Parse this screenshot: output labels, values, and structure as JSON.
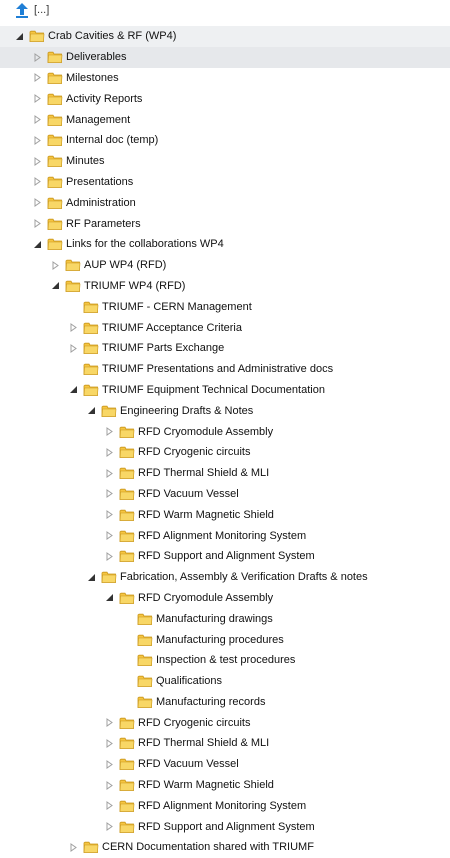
{
  "up": {
    "label": "[...]"
  },
  "tree": [
    {
      "label": "Crab Cavities & RF (WP4)",
      "depth": 0,
      "state": "expanded",
      "highlight": "first"
    },
    {
      "label": "Deliverables",
      "depth": 1,
      "state": "collapsed",
      "highlight": "selected"
    },
    {
      "label": "Milestones",
      "depth": 1,
      "state": "collapsed"
    },
    {
      "label": "Activity Reports",
      "depth": 1,
      "state": "collapsed"
    },
    {
      "label": "Management",
      "depth": 1,
      "state": "collapsed"
    },
    {
      "label": "Internal doc (temp)",
      "depth": 1,
      "state": "collapsed"
    },
    {
      "label": "Minutes",
      "depth": 1,
      "state": "collapsed"
    },
    {
      "label": "Presentations",
      "depth": 1,
      "state": "collapsed"
    },
    {
      "label": "Administration",
      "depth": 1,
      "state": "collapsed"
    },
    {
      "label": "RF Parameters",
      "depth": 1,
      "state": "collapsed"
    },
    {
      "label": "Links for the collaborations WP4",
      "depth": 1,
      "state": "expanded"
    },
    {
      "label": "AUP WP4 (RFD)",
      "depth": 2,
      "state": "collapsed"
    },
    {
      "label": "TRIUMF WP4 (RFD)",
      "depth": 2,
      "state": "expanded"
    },
    {
      "label": "TRIUMF - CERN Management",
      "depth": 3,
      "state": "leaf"
    },
    {
      "label": "TRIUMF Acceptance Criteria",
      "depth": 3,
      "state": "collapsed"
    },
    {
      "label": "TRIUMF Parts Exchange",
      "depth": 3,
      "state": "collapsed"
    },
    {
      "label": "TRIUMF Presentations and Administrative docs",
      "depth": 3,
      "state": "leaf"
    },
    {
      "label": "TRIUMF Equipment Technical Documentation",
      "depth": 3,
      "state": "expanded"
    },
    {
      "label": "Engineering Drafts & Notes",
      "depth": 4,
      "state": "expanded"
    },
    {
      "label": "RFD Cryomodule Assembly",
      "depth": 5,
      "state": "collapsed"
    },
    {
      "label": "RFD Cryogenic circuits",
      "depth": 5,
      "state": "collapsed"
    },
    {
      "label": "RFD Thermal Shield & MLI",
      "depth": 5,
      "state": "collapsed"
    },
    {
      "label": "RFD Vacuum Vessel",
      "depth": 5,
      "state": "collapsed"
    },
    {
      "label": "RFD Warm Magnetic Shield",
      "depth": 5,
      "state": "collapsed"
    },
    {
      "label": "RFD Alignment Monitoring System",
      "depth": 5,
      "state": "collapsed"
    },
    {
      "label": "RFD Support and Alignment System",
      "depth": 5,
      "state": "collapsed"
    },
    {
      "label": "Fabrication, Assembly & Verification Drafts & notes",
      "depth": 4,
      "state": "expanded"
    },
    {
      "label": "RFD Cryomodule Assembly",
      "depth": 5,
      "state": "expanded"
    },
    {
      "label": "Manufacturing drawings",
      "depth": 6,
      "state": "leaf"
    },
    {
      "label": "Manufacturing procedures",
      "depth": 6,
      "state": "leaf"
    },
    {
      "label": "Inspection & test procedures",
      "depth": 6,
      "state": "leaf"
    },
    {
      "label": "Qualifications",
      "depth": 6,
      "state": "leaf"
    },
    {
      "label": "Manufacturing records",
      "depth": 6,
      "state": "leaf"
    },
    {
      "label": "RFD Cryogenic circuits",
      "depth": 5,
      "state": "collapsed"
    },
    {
      "label": "RFD Thermal Shield & MLI",
      "depth": 5,
      "state": "collapsed"
    },
    {
      "label": "RFD Vacuum Vessel",
      "depth": 5,
      "state": "collapsed"
    },
    {
      "label": "RFD Warm Magnetic Shield",
      "depth": 5,
      "state": "collapsed"
    },
    {
      "label": "RFD Alignment Monitoring System",
      "depth": 5,
      "state": "collapsed"
    },
    {
      "label": "RFD Support and Alignment System",
      "depth": 5,
      "state": "collapsed"
    },
    {
      "label": "CERN Documentation shared with TRIUMF",
      "depth": 3,
      "state": "collapsed"
    }
  ],
  "colors": {
    "folder_fill": "#f5c542",
    "folder_edge": "#c9961a",
    "toggle_expanded": "#333333",
    "toggle_collapsed": "#a0a0a0",
    "up_arrow": "#1f7fd6"
  }
}
